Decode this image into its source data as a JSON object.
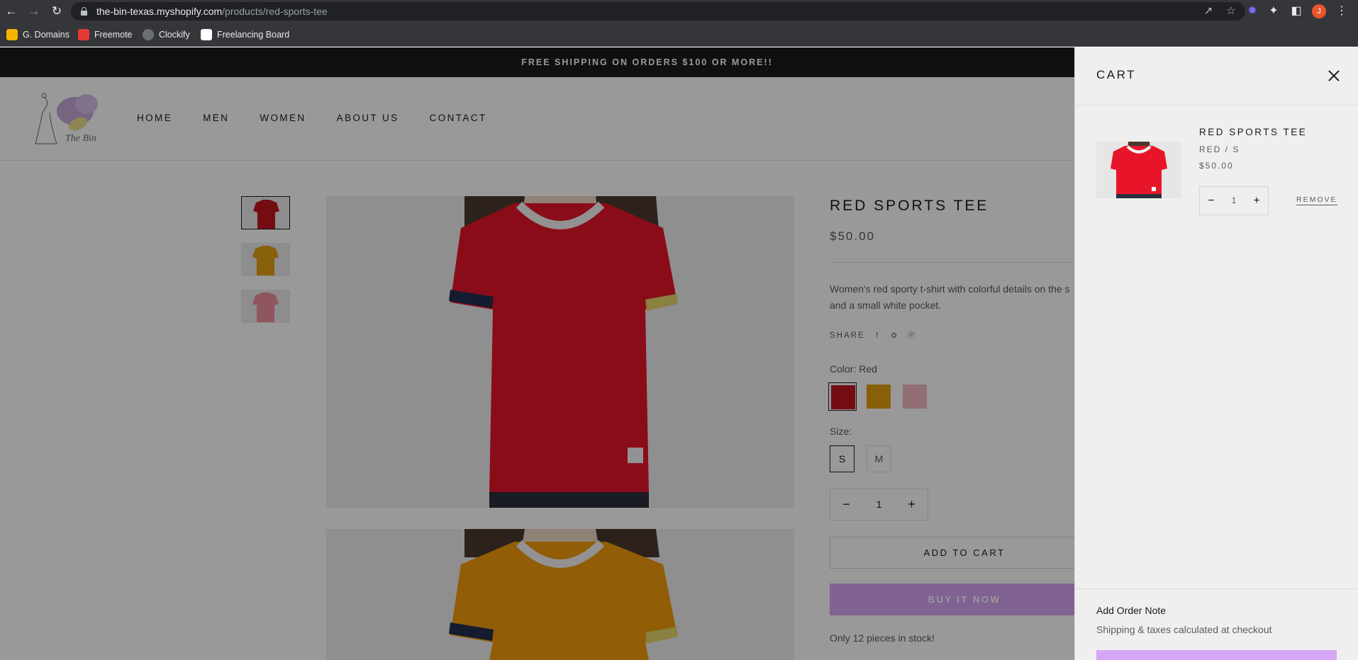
{
  "browser": {
    "url_host": "the-bin-texas.myshopify.com",
    "url_path": "/products/red-sports-tee",
    "avatar_initial": "J",
    "bookmarks": [
      {
        "label": "G. Domains",
        "color": "#f4b400"
      },
      {
        "label": "Freemote",
        "color": "#e53935"
      },
      {
        "label": "Clockify",
        "color": "#6c6f74"
      },
      {
        "label": "Freelancing Board",
        "color": "#ffffff"
      }
    ]
  },
  "store": {
    "announcement": "FREE SHIPPING ON ORDERS $100 OR MORE!!",
    "nav": [
      "HOME",
      "MEN",
      "WOMEN",
      "ABOUT US",
      "CONTACT"
    ]
  },
  "product": {
    "title": "RED SPORTS TEE",
    "price": "$50.00",
    "description_line1": "Women's red sporty t-shirt with colorful details on the s",
    "description_line2": "and a small white pocket.",
    "share_label": "SHARE",
    "color_label": "Color: Red",
    "colors": [
      "#c0161f",
      "#e2a10f",
      "#f1b8c2"
    ],
    "size_label": "Size:",
    "sizes": [
      "S",
      "M"
    ],
    "quantity": "1",
    "add_to_cart": "ADD TO CART",
    "buy_now": "BUY IT NOW",
    "stock": "Only 12 pieces in stock!"
  },
  "cart": {
    "title": "CART",
    "item": {
      "name": "RED SPORTS TEE",
      "variant": "RED / S",
      "price": "$50.00",
      "quantity": "1",
      "remove": "REMOVE"
    },
    "order_note": "Add Order Note",
    "shipping_note": "Shipping & taxes calculated at checkout"
  }
}
